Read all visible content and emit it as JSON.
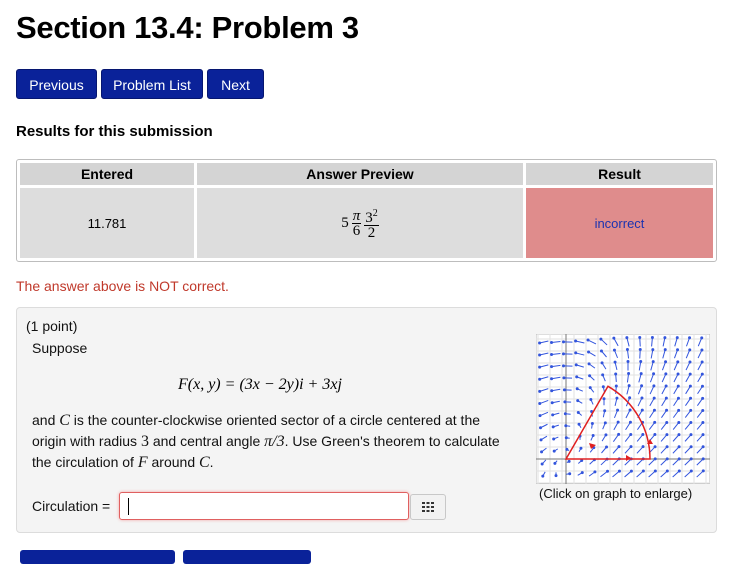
{
  "page": {
    "title": "Section 13.4: Problem 3"
  },
  "nav": {
    "previous": "Previous",
    "problem_list": "Problem List",
    "next": "Next"
  },
  "results": {
    "heading": "Results for this submission",
    "columns": [
      "Entered",
      "Answer Preview",
      "Result"
    ],
    "row": {
      "entered": "11.781",
      "result": "incorrect"
    },
    "preview": {
      "coef": "5",
      "num1": "π",
      "den1": "6",
      "num2": "3",
      "exp": "2",
      "den2": "2"
    },
    "message": "The answer above is NOT correct."
  },
  "problem": {
    "points": "(1 point)",
    "suppose": "Suppose",
    "field_lhs": "F(x, y) = ",
    "field_rhs_a": "(3x − 2y)i",
    "field_rhs_b": " + 3xj",
    "para_and": "and ",
    "C": "C",
    "para_1": " is the counter-clockwise oriented sector of a circle centered at the origin with radius ",
    "radius": "3",
    "para_2": " and central angle ",
    "angle": "π/3",
    "para_3": ". Use Green's theorem to calculate the circulation of ",
    "F": "F",
    "para_4": " around ",
    "para_5": ".",
    "answer_label": "Circulation =",
    "answer_value": "",
    "graph_caption": "(Click on graph to enlarge)"
  },
  "colors": {
    "accent": "#0a2299",
    "incorrect_bg": "#df8c8c",
    "error_text": "#c0392b",
    "arrow": "#3355dd",
    "sector": "#e02020"
  },
  "icons": {
    "keyboard": "keyboard-grid-icon"
  }
}
